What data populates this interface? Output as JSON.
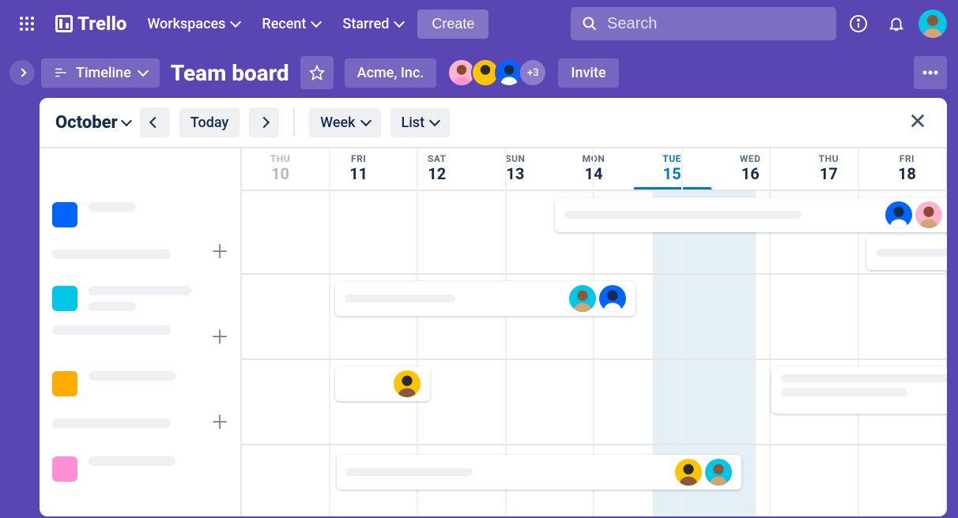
{
  "brand": "Trello",
  "nav": {
    "workspaces": "Workspaces",
    "recent": "Recent",
    "starred": "Starred",
    "create": "Create"
  },
  "search": {
    "placeholder": "Search"
  },
  "view": {
    "label": "Timeline"
  },
  "board": {
    "name": "Team board",
    "workspace": "Acme, Inc.",
    "extra_members": "+3",
    "invite": "Invite"
  },
  "timeline": {
    "month": "October",
    "today": "Today",
    "span": "Week",
    "group": "List",
    "days": [
      {
        "dow": "THU",
        "num": "10",
        "state": "faded"
      },
      {
        "dow": "FRI",
        "num": "11",
        "state": ""
      },
      {
        "dow": "SAT",
        "num": "12",
        "state": ""
      },
      {
        "dow": "SUN",
        "num": "13",
        "state": ""
      },
      {
        "dow": "MON",
        "num": "14",
        "state": ""
      },
      {
        "dow": "TUE",
        "num": "15",
        "state": "today"
      },
      {
        "dow": "WED",
        "num": "16",
        "state": ""
      },
      {
        "dow": "THU",
        "num": "17",
        "state": ""
      },
      {
        "dow": "FRI",
        "num": "18",
        "state": ""
      }
    ]
  },
  "colors": {
    "primary": "#5a46b2",
    "accent": "#0079bf"
  },
  "lanes": [
    {
      "icon": "blue-bars"
    },
    {
      "icon": "teal-stripes"
    },
    {
      "icon": "orange-sq"
    },
    {
      "icon": "pink-sq"
    }
  ]
}
